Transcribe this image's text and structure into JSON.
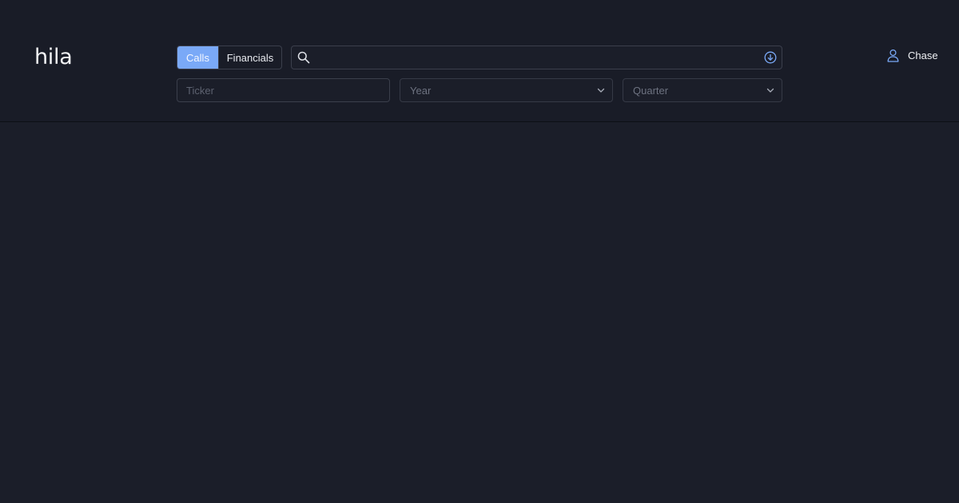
{
  "app": {
    "logo": "hila"
  },
  "mode_toggle": {
    "options": [
      "Calls",
      "Financials"
    ],
    "selected": "Calls"
  },
  "search": {
    "value": "",
    "placeholder": "",
    "icon": "search-icon",
    "submit_icon": "arrow-down-circle-icon"
  },
  "filters": {
    "ticker": {
      "placeholder": "Ticker",
      "value": ""
    },
    "year": {
      "placeholder": "Year",
      "value": ""
    },
    "quarter": {
      "placeholder": "Quarter",
      "value": ""
    }
  },
  "user": {
    "name": "Chase",
    "icon": "user-icon"
  },
  "colors": {
    "accent": "#7aa9f7",
    "background": "#1b1e29",
    "border": "#3b3f4c"
  }
}
